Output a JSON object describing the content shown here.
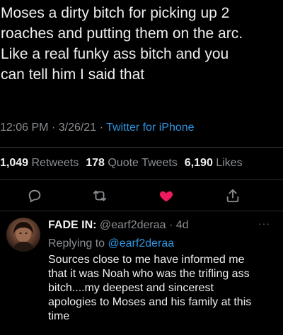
{
  "main_tweet": {
    "text": "Moses a dirty bitch for picking up 2\nroaches and putting them on the arc.\nLike a real funky ass bitch and you\ncan tell him I said that",
    "time": "12:06 PM",
    "date": "3/26/21",
    "separator": "·",
    "source": "Twitter for iPhone"
  },
  "stats": {
    "retweets_count": "1,049",
    "retweets_label": "Retweets",
    "quotes_count": "178",
    "quotes_label": "Quote Tweets",
    "likes_count": "6,190",
    "likes_label": "Likes"
  },
  "actions": {
    "reply_icon": "speech-bubble-icon",
    "retweet_icon": "retweet-icon",
    "like_icon": "heart-icon",
    "share_icon": "share-icon",
    "like_color": "#f0195f",
    "icon_color": "#8b8f94"
  },
  "reply": {
    "name": "FADE IN:",
    "handle": "@earf2deraa",
    "separator": "·",
    "age": "4d",
    "more": "···",
    "replying_prefix": "Replying to",
    "replying_handle": "@earf2deraa",
    "text": "Sources close to me have informed me\nthat it was Noah who was the trifling ass\nbitch....my deepest and sincerest\napologies to Moses and his family at this\ntime"
  },
  "colors": {
    "background": "#000000",
    "text": "#efefef",
    "muted": "#8b8f94",
    "link": "#2f95e0",
    "divider": "#2a2d30"
  }
}
